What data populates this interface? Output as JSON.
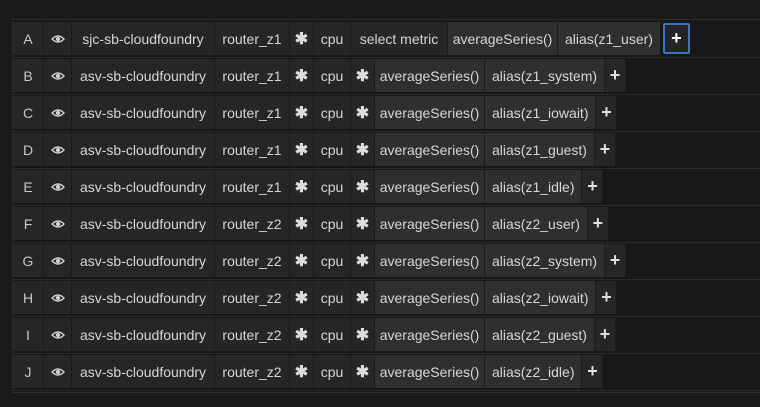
{
  "colors": {
    "background": "#1a1a1a",
    "segment": "#262626",
    "function_segment": "#2f2f2f",
    "active_border": "#3a74c4"
  },
  "icons": {
    "visibility": "eye-icon",
    "wildcard": "asterisk-icon",
    "add": "plus-icon"
  },
  "queries": [
    {
      "letter": "A",
      "host": "sjc-sb-cloudfoundry",
      "router": "router_z1",
      "wildcard": "✱",
      "metric": "cpu",
      "second": "select metric",
      "avg": "averageSeries()",
      "alias": "alias(z1_user)",
      "add": "+"
    },
    {
      "letter": "B",
      "host": "asv-sb-cloudfoundry",
      "router": "router_z1",
      "wildcard": "✱",
      "metric": "cpu",
      "second": "✱",
      "avg": "averageSeries()",
      "alias": "alias(z1_system)",
      "add": "+"
    },
    {
      "letter": "C",
      "host": "asv-sb-cloudfoundry",
      "router": "router_z1",
      "wildcard": "✱",
      "metric": "cpu",
      "second": "✱",
      "avg": "averageSeries()",
      "alias": "alias(z1_iowait)",
      "add": "+"
    },
    {
      "letter": "D",
      "host": "asv-sb-cloudfoundry",
      "router": "router_z1",
      "wildcard": "✱",
      "metric": "cpu",
      "second": "✱",
      "avg": "averageSeries()",
      "alias": "alias(z1_guest)",
      "add": "+"
    },
    {
      "letter": "E",
      "host": "asv-sb-cloudfoundry",
      "router": "router_z1",
      "wildcard": "✱",
      "metric": "cpu",
      "second": "✱",
      "avg": "averageSeries()",
      "alias": "alias(z1_idle)",
      "add": "+"
    },
    {
      "letter": "F",
      "host": "asv-sb-cloudfoundry",
      "router": "router_z2",
      "wildcard": "✱",
      "metric": "cpu",
      "second": "✱",
      "avg": "averageSeries()",
      "alias": "alias(z2_user)",
      "add": "+"
    },
    {
      "letter": "G",
      "host": "asv-sb-cloudfoundry",
      "router": "router_z2",
      "wildcard": "✱",
      "metric": "cpu",
      "second": "✱",
      "avg": "averageSeries()",
      "alias": "alias(z2_system)",
      "add": "+"
    },
    {
      "letter": "H",
      "host": "asv-sb-cloudfoundry",
      "router": "router_z2",
      "wildcard": "✱",
      "metric": "cpu",
      "second": "✱",
      "avg": "averageSeries()",
      "alias": "alias(z2_iowait)",
      "add": "+"
    },
    {
      "letter": "I",
      "host": "asv-sb-cloudfoundry",
      "router": "router_z2",
      "wildcard": "✱",
      "metric": "cpu",
      "second": "✱",
      "avg": "averageSeries()",
      "alias": "alias(z2_guest)",
      "add": "+"
    },
    {
      "letter": "J",
      "host": "asv-sb-cloudfoundry",
      "router": "router_z2",
      "wildcard": "✱",
      "metric": "cpu",
      "second": "✱",
      "avg": "averageSeries()",
      "alias": "alias(z2_idle)",
      "add": "+"
    }
  ]
}
